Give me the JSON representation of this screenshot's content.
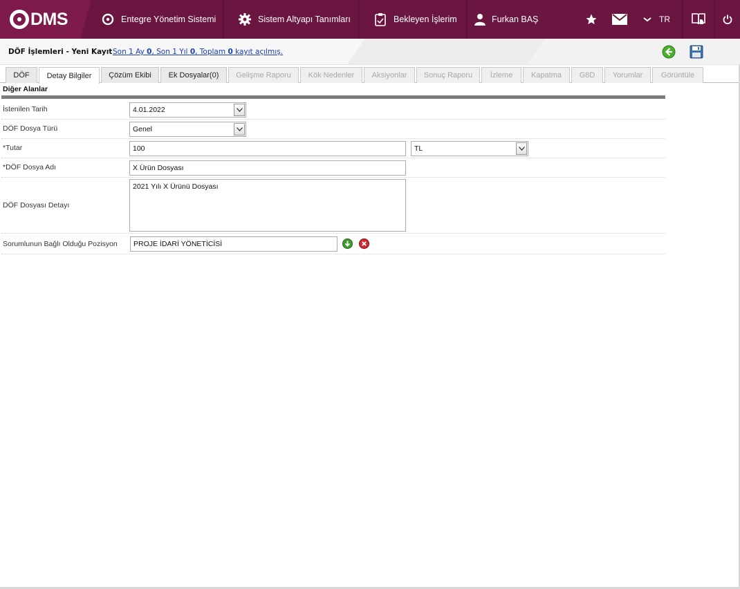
{
  "app": {
    "logo_text": "DMS",
    "colors": {
      "topbar": "#6b1640",
      "accent_green": "#3b9a2c",
      "accent_red": "#c8242b"
    }
  },
  "nav": {
    "items": [
      {
        "label": "Entegre Yönetim Sistemi",
        "icon": "qdms-circle-icon"
      },
      {
        "label": "Sistem Altyapı Tanımları",
        "icon": "gear-icon"
      },
      {
        "label": "Bekleyen İşlerim",
        "icon": "clipboard-check-icon"
      },
      {
        "label": "Furkan BAŞ",
        "icon": "user-icon"
      }
    ],
    "language": "TR",
    "right_icons": [
      "star-icon",
      "mail-icon",
      "chevron-down-icon",
      "book-help-icon",
      "power-icon"
    ]
  },
  "header": {
    "title": "DÖF İşlemleri - Yeni Kayıt",
    "summary_prefix1": "Son 1 Ay ",
    "summary_val1": "0",
    "summary_prefix2": ", Son 1 Yıl ",
    "summary_val2": "0",
    "summary_prefix3": ", Toplam ",
    "summary_val3": "0",
    "summary_suffix": " kayıt açılmış."
  },
  "tabs": [
    {
      "label": "DÖF",
      "state": "normal"
    },
    {
      "label": "Detay Bilgiler",
      "state": "active"
    },
    {
      "label": "Çözüm Ekibi",
      "state": "normal"
    },
    {
      "label": "Ek Dosyalar(0)",
      "state": "normal"
    },
    {
      "label": "Gelişme Raporu",
      "state": "disabled"
    },
    {
      "label": "Kök Nedenler",
      "state": "disabled"
    },
    {
      "label": "Aksiyonlar",
      "state": "disabled"
    },
    {
      "label": "Sonuç Raporu",
      "state": "disabled"
    },
    {
      "label": "İzleme",
      "state": "disabled"
    },
    {
      "label": "Kapatma",
      "state": "disabled"
    },
    {
      "label": "G8D",
      "state": "disabled"
    },
    {
      "label": "Yorumlar",
      "state": "disabled"
    },
    {
      "label": "Görüntüle",
      "state": "disabled"
    }
  ],
  "form": {
    "section_title": "Diğer Alanlar",
    "fields": {
      "requested_date": {
        "label": "İstenilen Tarih",
        "value": "4.01.2022"
      },
      "file_type": {
        "label": "DÖF Dosya Türü",
        "value": "Genel"
      },
      "amount": {
        "label": "*Tutar",
        "value": "100",
        "currency": "TL"
      },
      "file_name": {
        "label": "*DÖF Dosya Adı",
        "value": "X Ürün Dosyası"
      },
      "file_detail": {
        "label": "DÖF Dosyası Detayı",
        "value": "2021 Yılı X Ürünü Dosyası"
      },
      "position": {
        "label": "Sorumlunun Bağlı Olduğu Pozisyon",
        "value": "PROJE İDARİ YÖNETİCİSİ"
      }
    }
  }
}
